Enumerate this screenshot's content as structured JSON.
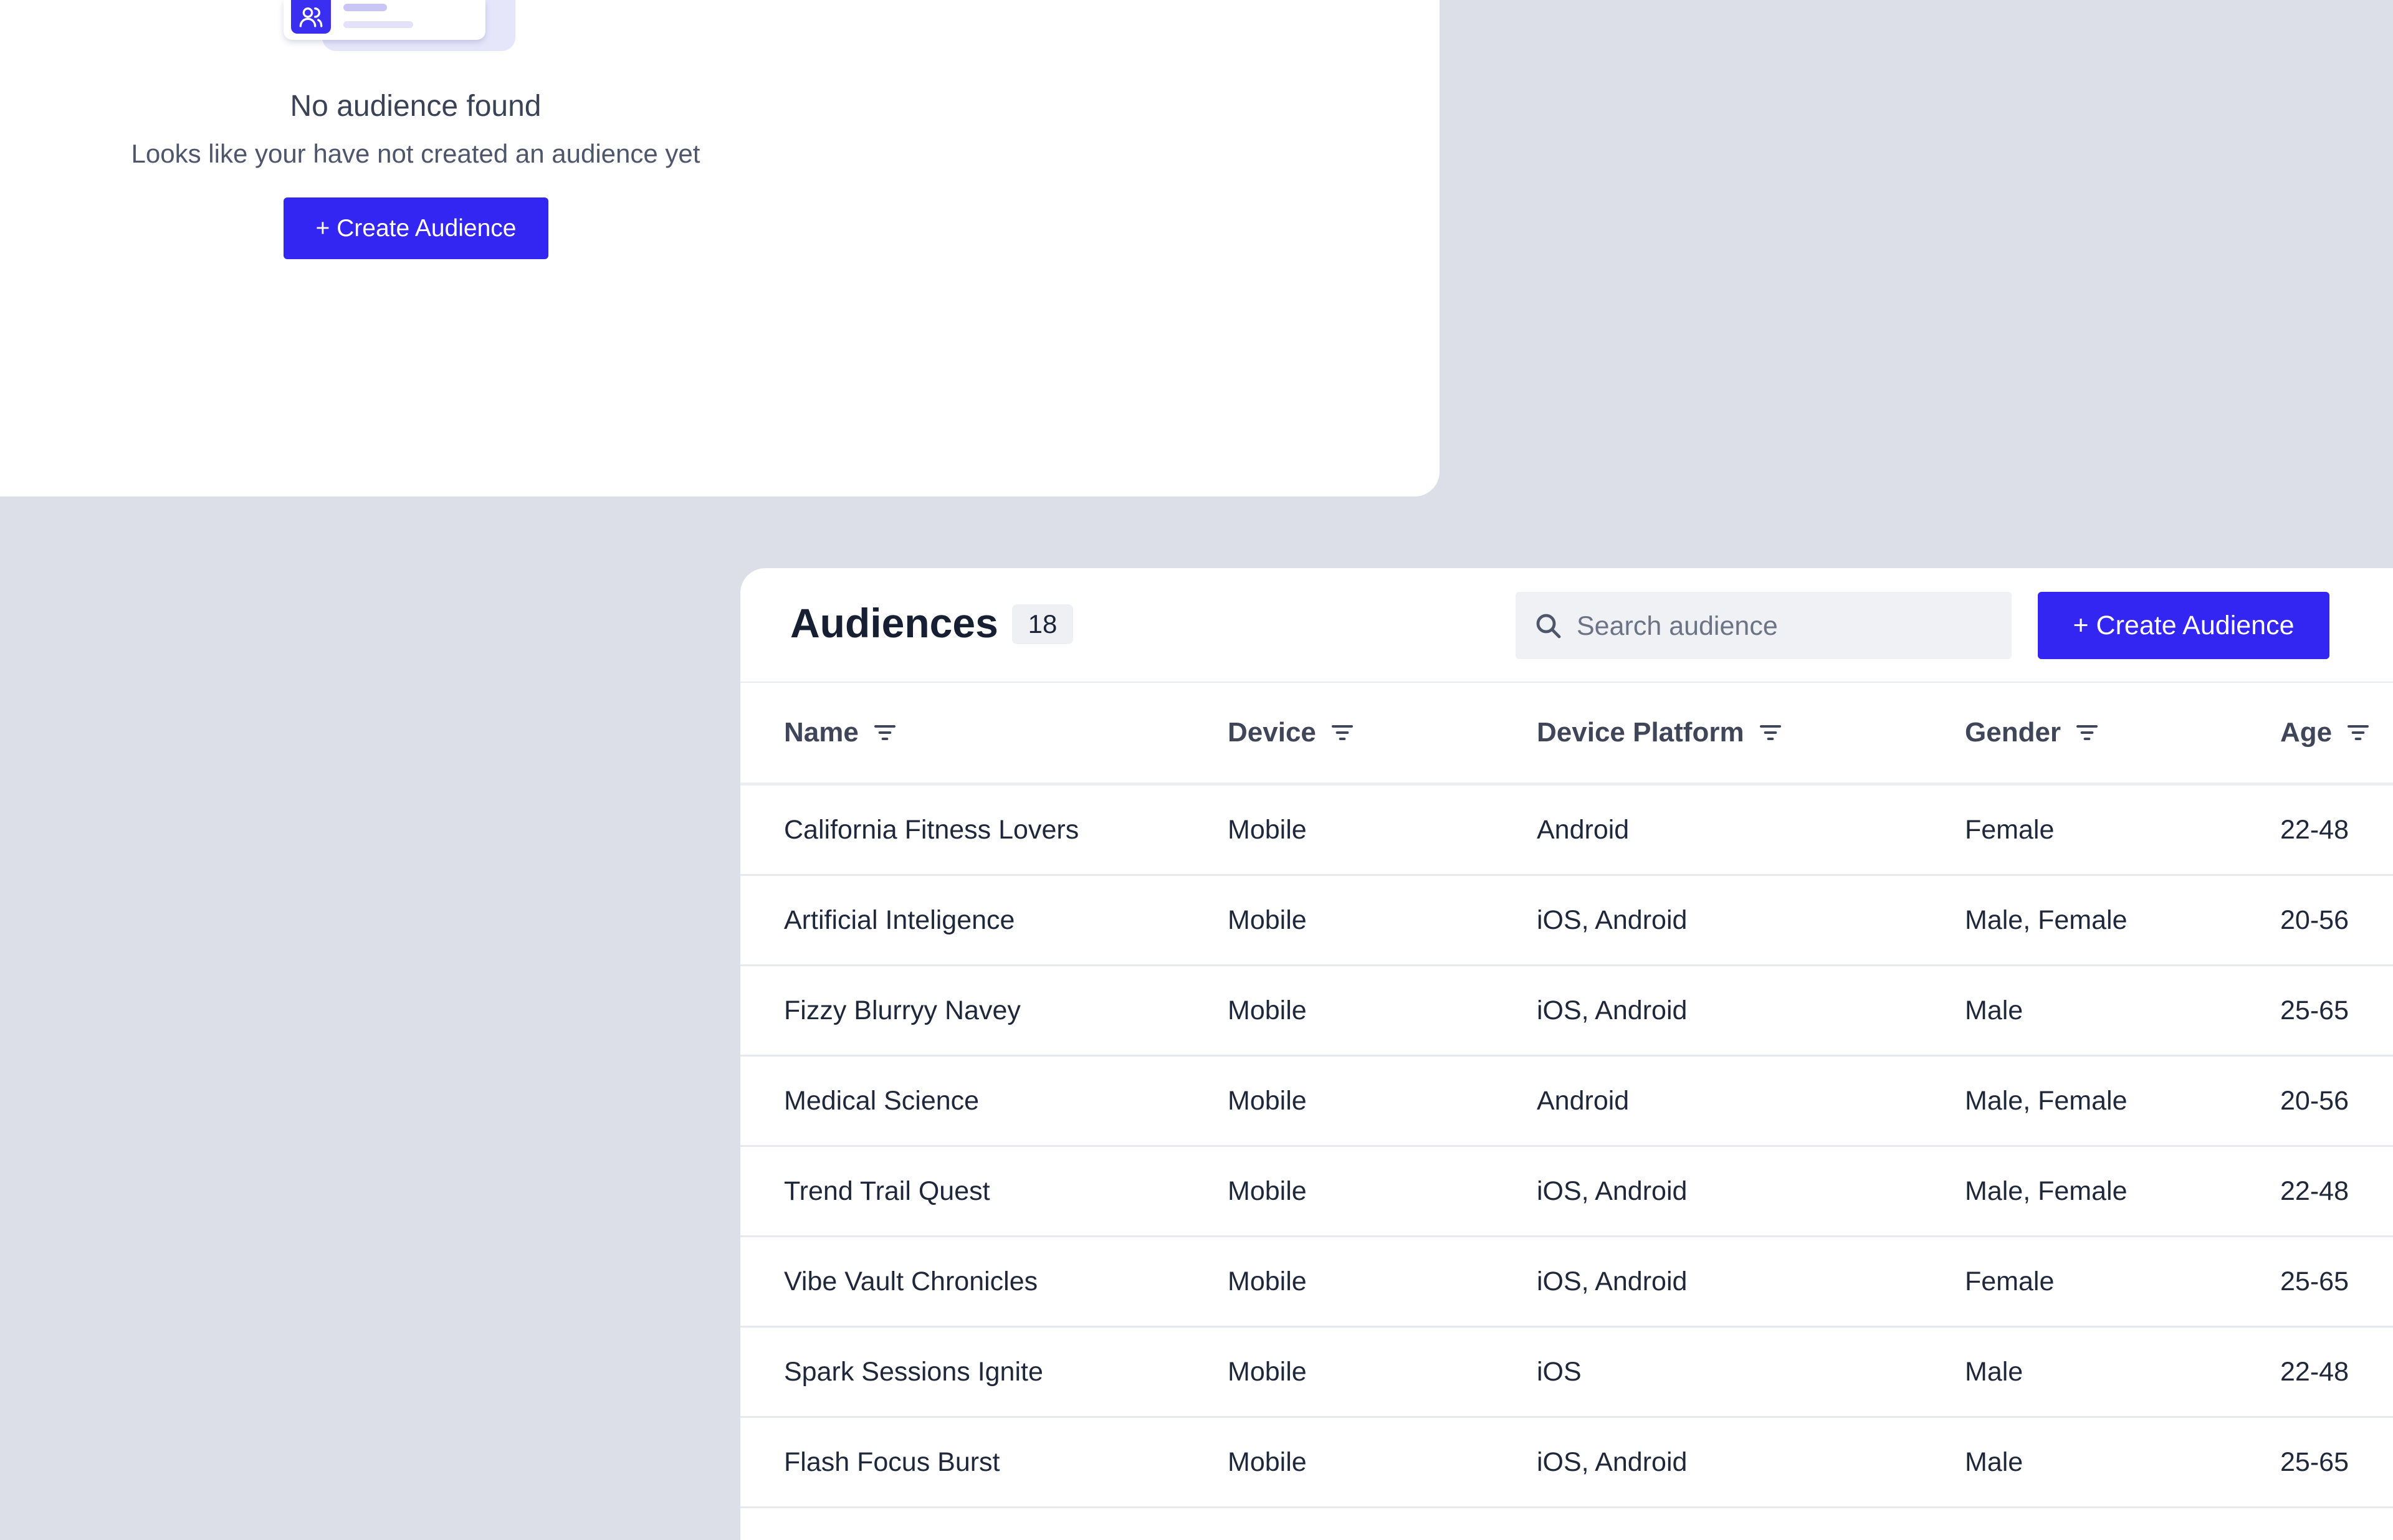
{
  "empty_state": {
    "title": "No audience found",
    "subtitle": "Looks like your have not created an audience yet",
    "create_label": "+ Create Audience",
    "illustration_icon": "user-group-icon"
  },
  "audiences": {
    "title": "Audiences",
    "count": "18",
    "search": {
      "placeholder": "Search audience",
      "value": "",
      "icon": "search-icon"
    },
    "create_label": "+ Create Audience",
    "columns": [
      {
        "label": "Name",
        "icon": "filter-icon"
      },
      {
        "label": "Device",
        "icon": "filter-icon"
      },
      {
        "label": "Device Platform",
        "icon": "filter-icon"
      },
      {
        "label": "Gender",
        "icon": "filter-icon"
      },
      {
        "label": "Age",
        "icon": "filter-icon"
      }
    ],
    "rows": [
      {
        "name": "California Fitness Lovers",
        "device": "Mobile",
        "platform": "Android",
        "gender": "Female",
        "age": "22-48"
      },
      {
        "name": "Artificial Inteligence",
        "device": "Mobile",
        "platform": "iOS, Android",
        "gender": "Male, Female",
        "age": "20-56"
      },
      {
        "name": "Fizzy Blurryy Navey",
        "device": "Mobile",
        "platform": "iOS, Android",
        "gender": "Male",
        "age": "25-65"
      },
      {
        "name": "Medical Science",
        "device": "Mobile",
        "platform": "Android",
        "gender": "Male, Female",
        "age": "20-56"
      },
      {
        "name": "Trend Trail Quest",
        "device": "Mobile",
        "platform": "iOS, Android",
        "gender": "Male, Female",
        "age": "22-48"
      },
      {
        "name": "Vibe Vault Chronicles",
        "device": "Mobile",
        "platform": "iOS, Android",
        "gender": "Female",
        "age": "25-65"
      },
      {
        "name": "Spark Sessions Ignite",
        "device": "Mobile",
        "platform": "iOS",
        "gender": "Male",
        "age": "22-48"
      },
      {
        "name": "Flash Focus Burst",
        "device": "Mobile",
        "platform": "iOS, Android",
        "gender": "Male",
        "age": "25-65"
      }
    ]
  },
  "colors": {
    "background": "#dcdfe7",
    "card": "#ffffff",
    "accent": "#3325f2",
    "text": "#1b2437",
    "muted": "#6b7385"
  }
}
